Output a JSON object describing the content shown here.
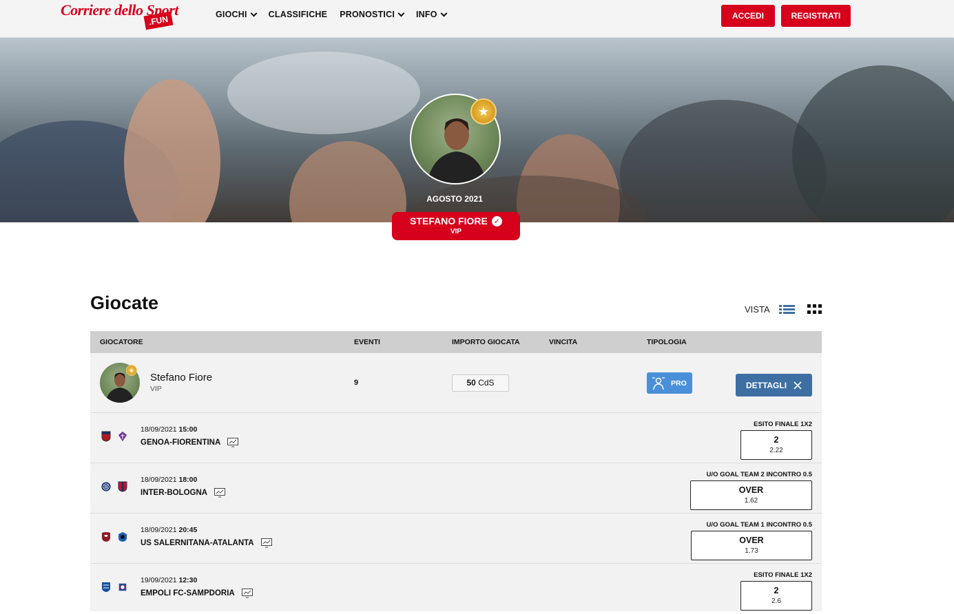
{
  "nav": {
    "logo_main": "Corriere dello Sport",
    "logo_badge": ".FUN",
    "menu": [
      {
        "label": "GIOCHI",
        "dropdown": true
      },
      {
        "label": "CLASSIFICHE",
        "dropdown": false
      },
      {
        "label": "PRONOSTICI",
        "dropdown": true
      },
      {
        "label": "INFO",
        "dropdown": true
      }
    ],
    "login_label": "ACCEDI",
    "register_label": "REGISTRATI"
  },
  "hero": {
    "date_label": "AGOSTO 2021",
    "user_name": "STEFANO FIORE",
    "user_tier": "VIP"
  },
  "section": {
    "title": "Giocate",
    "view_label": "VISTA"
  },
  "table": {
    "headers": {
      "player": "GIOCATORE",
      "events": "EVENTI",
      "amount": "IMPORTO GIOCATA",
      "win": "VINCITA",
      "type": "TIPOLOGIA"
    },
    "play": {
      "player_name": "Stefano Fiore",
      "player_tier": "VIP",
      "events": "9",
      "amount_value": "50",
      "amount_unit": "CdS",
      "type_label": "PRO",
      "details_label": "DETTAGLI"
    },
    "events": [
      {
        "date": "18/09/2021",
        "time": "15:00",
        "match": "GENOA-FIORENTINA",
        "market": "ESITO FINALE 1X2",
        "pick": "2",
        "odds": "2.22"
      },
      {
        "date": "18/09/2021",
        "time": "18:00",
        "match": "INTER-BOLOGNA",
        "market": "U/O GOAL TEAM 2 INCONTRO 0.5",
        "pick": "OVER",
        "odds": "1.62"
      },
      {
        "date": "18/09/2021",
        "time": "20:45",
        "match": "US SALERNITANA-ATALANTA",
        "market": "U/O GOAL TEAM 1 INCONTRO 0.5",
        "pick": "OVER",
        "odds": "1.73"
      },
      {
        "date": "19/09/2021",
        "time": "12:30",
        "match": "EMPOLI FC-SAMPDORIA",
        "market": "ESITO FINALE 1X2",
        "pick": "2",
        "odds": "2.6"
      }
    ]
  },
  "colors": {
    "brand_red": "#d6001c",
    "pro_blue": "#4a90d9",
    "details_blue": "#3e6fa3"
  }
}
